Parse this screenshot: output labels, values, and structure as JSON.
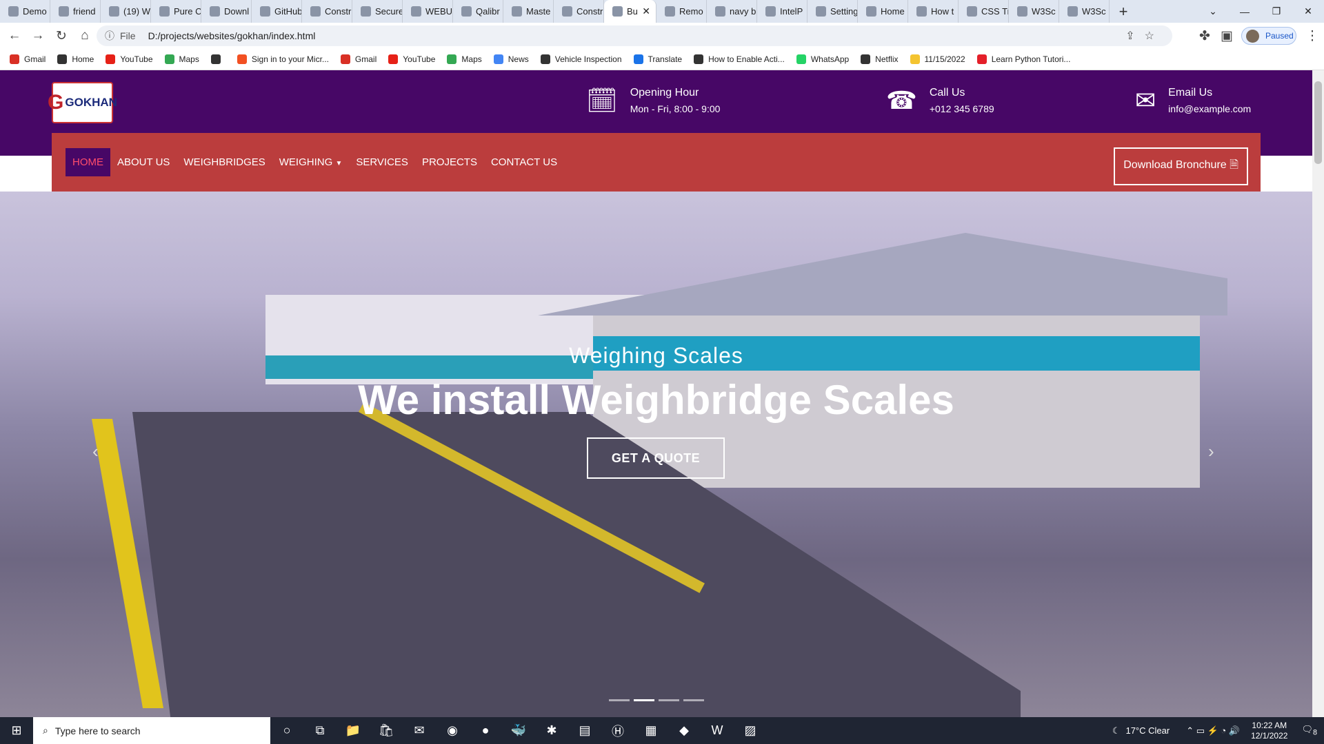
{
  "browser": {
    "tabs": [
      "Demo",
      "friend",
      "(19) W",
      "Pure C",
      "Downl",
      "GitHub",
      "Constr",
      "Secure",
      "WEBU",
      "Qalibr",
      "Maste",
      "Constr",
      "Bu",
      "Remo",
      "navy b",
      "IntelP",
      "Setting",
      "Home",
      "How t",
      "CSS Tr",
      "W3Sc",
      "W3Sc"
    ],
    "active_tab_index": 12,
    "address_prefix": "File",
    "address": "D:/projects/websites/gokhan/index.html",
    "profile_status": "Paused"
  },
  "bookmarks": [
    "Gmail",
    "Home",
    "YouTube",
    "Maps",
    "",
    "Sign in to your Micr...",
    "Gmail",
    "YouTube",
    "Maps",
    "News",
    "Vehicle Inspection",
    "Translate",
    "How to Enable Acti...",
    "WhatsApp",
    "Netflix",
    "11/15/2022",
    "Learn Python Tutori..."
  ],
  "site": {
    "logo_text": "GOKHAN",
    "opening": {
      "title": "Opening Hour",
      "value": "Mon - Fri, 8:00 - 9:00"
    },
    "call": {
      "title": "Call Us",
      "value": "+012 345 6789"
    },
    "email": {
      "title": "Email Us",
      "value": "info@example.com"
    },
    "nav": [
      "HOME",
      "ABOUT US",
      "WEIGHBRIDGES",
      "WEIGHING",
      "SERVICES",
      "PROJECTS",
      "CONTACT US"
    ],
    "download_label": "Download Bronchure",
    "hero": {
      "subtitle": "Weighing Scales",
      "title": "We install Weighbridge Scales",
      "cta": "GET A QUOTE",
      "slides": 4,
      "active_slide": 1
    }
  },
  "taskbar": {
    "search_placeholder": "Type here to search",
    "weather": "17°C  Clear",
    "time": "10:22 AM",
    "date": "12/1/2022",
    "notif_count": "8"
  }
}
